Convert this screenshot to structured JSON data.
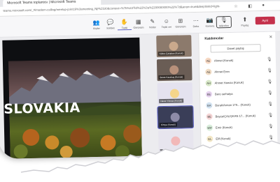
{
  "browser": {
    "tab_title": "Microsoft Teams toplantısı | Microsoft Teams",
    "address": "teams.microsoft.com/_#/modern-calling/meetup-join/19%3ameeting_NjFkZGI0&context=%7b%22Tid%22%3a%2200000000%22%7d&anon=true&deeplinkId=light-meeting",
    "window_controls": [
      "–",
      "□",
      "✕"
    ]
  },
  "toolbar": {
    "items": [
      {
        "label": "Kişiler",
        "icon": "people-icon",
        "glyph": "👥"
      },
      {
        "label": "Sohbet",
        "icon": "chat-icon",
        "glyph": "💬"
      },
      {
        "label": "Tepki",
        "icon": "raise-hand-icon",
        "glyph": "✋"
      },
      {
        "label": "Görünüm",
        "icon": "view-icon",
        "glyph": "▦"
      },
      {
        "label": "Notlar",
        "icon": "notes-icon",
        "glyph": "✎"
      },
      {
        "label": "Tepki ver",
        "icon": "react-icon",
        "glyph": "☺"
      },
      {
        "label": "Görünüm",
        "icon": "layout-icon",
        "glyph": "⊞"
      },
      {
        "label": "Daha",
        "icon": "more-icon",
        "glyph": "⋯"
      },
      {
        "label": "Kamera",
        "icon": "camera-icon",
        "glyph": "📷"
      },
      {
        "label": "Mikrofon",
        "icon": "mic-icon",
        "glyph": "🎙"
      },
      {
        "label": "Paylaş",
        "icon": "share-icon",
        "glyph": "⬆"
      }
    ],
    "leave_label": "Ayrıl",
    "accent": "#5b5fc7",
    "leave_color": "#c4314b"
  },
  "share": {
    "title": "SLOVAKIA"
  },
  "thumbnails": [
    {
      "name": "Kübra Çalışkan (Konuk)"
    },
    {
      "name": "Beste Karakuş (Konuk)"
    },
    {
      "name": "Hacer Yılmaz (Konuk)"
    },
    {
      "name": "Kimya (Konuk)"
    },
    {
      "name": ""
    }
  ],
  "panel": {
    "title": "Katılımcılar",
    "close_icon": "close-icon",
    "invite_label": "Davet paylaş",
    "participants": [
      {
        "initials": "AE",
        "name": "Ahmet (Konuk)",
        "color": "#f7d9c4"
      },
      {
        "initials": "AE",
        "name": "Ahmet Eren",
        "color": "#f1dcc4"
      },
      {
        "initials": "AH",
        "name": "Ahmet Hamza (Konuk)",
        "color": "#d8e8c8"
      },
      {
        "initials": "BE",
        "name": "Bero serhatya",
        "color": "#e6d3ef"
      },
      {
        "initials": "BA",
        "name": "Burak/Anıtan 179... (Konuk)",
        "color": "#d3e3f1"
      },
      {
        "initials": "BE",
        "name": "Beyza/ÇALIŞKAN 17... (Konuk)",
        "color": "#f5d5d5"
      },
      {
        "initials": "EM",
        "name": "Emir (Konuk)",
        "color": "#d9eedb"
      },
      {
        "initials": "EL",
        "name": "Elif (Konuk)",
        "color": "#f3e7c6"
      }
    ]
  }
}
